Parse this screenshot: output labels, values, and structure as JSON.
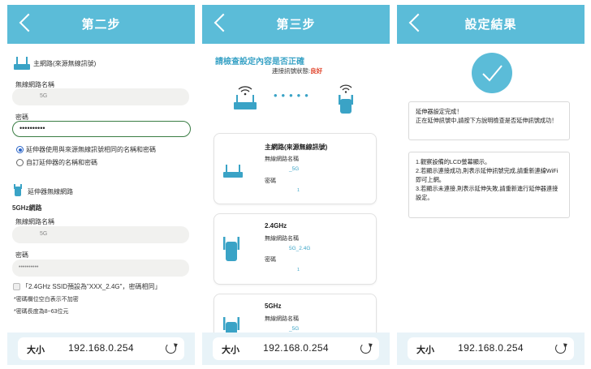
{
  "colors": {
    "header": "#5bbcd8",
    "accent": "#3aa3c6",
    "good": "#e0442b",
    "check_circle": "#5bbcd8"
  },
  "panel1": {
    "title": "第二步",
    "main_router_label": "主網路(來源無線訊號)",
    "ssid_label": "無線網路名稱",
    "ssid_value": "5G",
    "password_label": "密碼",
    "password_value": "••••••••••",
    "radio_same": "延伸器使用與來源無線訊號相同的名稱和密碼",
    "radio_custom": "自訂延伸器的名稱和密碼",
    "extender_label": "延伸器無線網路",
    "band_5g": "5GHz網路",
    "ext_ssid_label": "無線網路名稱",
    "ext_ssid_value": "5G",
    "ext_password_label": "密碼",
    "ext_password_value": "••••••••••",
    "checkbox_text": "「2.4GHz SSID預設為\"XXX_2.4G\"，密碼相同」",
    "note1": "*密碼欄位空白表示不加密",
    "note2": "*密碼長度為8~63位元"
  },
  "panel2": {
    "title": "第三步",
    "check_heading": "請檢查設定內容是否正確",
    "status_label": "連接訊號狀態:",
    "status_value": "良好",
    "card1": {
      "title": "主網路(來源無線訊號)",
      "ssid_label": "無線網路名稱",
      "ssid_value": "_5G",
      "pw_label": "密碼",
      "pw_value": "1"
    },
    "card2": {
      "title": "2.4GHz",
      "ssid_label": "無線網路名稱",
      "ssid_value": "5G_2.4G",
      "pw_label": "密碼",
      "pw_value": "1"
    },
    "card3": {
      "title": "5GHz",
      "ssid_label": "無線網路名稱",
      "ssid_value": "_5G"
    }
  },
  "panel3": {
    "title": "設定結果",
    "msg1": "延伸器設定完成！\n正在延伸訊號中,請按下方說明檢查是否延伸訊號成功！",
    "msg2": "1.觀察設備的LCD螢幕顯示。\n2.若顯示連接成功,則表示延伸訊號完成,請重新連線WiFi即可上網。\n3.若顯示未連接,則表示延伸失敗,請重新進行延伸器連接設定。"
  },
  "urlbar": {
    "size_label": "大小",
    "url": "192.168.0.254"
  }
}
